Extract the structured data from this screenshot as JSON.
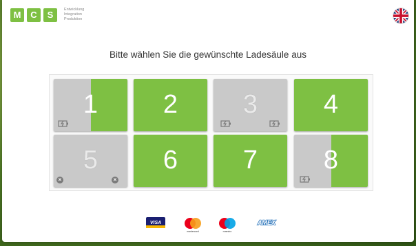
{
  "header": {
    "logo_letters": [
      "M",
      "C",
      "S"
    ],
    "tagline": [
      "Entwicklung",
      "Integration",
      "Produktion"
    ],
    "language_icon": "uk-flag-icon"
  },
  "main": {
    "title": "Bitte wählen Sie die gewünschte Ladesäule aus"
  },
  "stations": [
    {
      "label": "1",
      "status": "charging",
      "charge_fraction": 0.5
    },
    {
      "label": "2",
      "status": "available"
    },
    {
      "label": "3",
      "status": "occupied"
    },
    {
      "label": "4",
      "status": "available"
    },
    {
      "label": "5",
      "status": "out-of-service"
    },
    {
      "label": "6",
      "status": "available"
    },
    {
      "label": "7",
      "status": "available"
    },
    {
      "label": "8",
      "status": "charging",
      "charge_fraction": 0.5
    }
  ],
  "payment": {
    "cards": [
      {
        "name": "visa",
        "text": "VISA"
      },
      {
        "name": "mastercard",
        "text": "mastercard"
      },
      {
        "name": "maestro",
        "text": "maestro"
      },
      {
        "name": "amex",
        "text": "AMEX"
      }
    ]
  },
  "colors": {
    "available": "#7ec043",
    "unavailable": "#c9c9c9",
    "icon": "#7a7a7a"
  }
}
